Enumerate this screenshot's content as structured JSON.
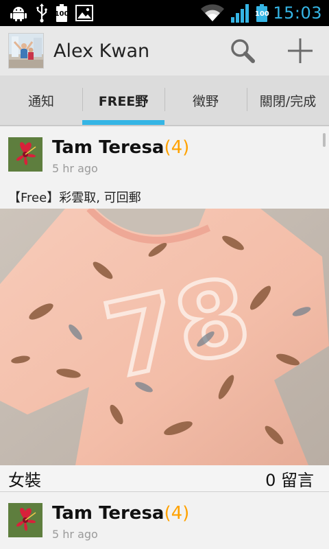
{
  "status_bar": {
    "battery_1": "100",
    "battery_2": "100",
    "time": "15:03",
    "icons": [
      "android-debug-icon",
      "usb-icon",
      "battery-icon",
      "image-icon",
      "wifi-icon",
      "signal-icon",
      "battery-charging-icon"
    ]
  },
  "action_bar": {
    "title": "Alex Kwan",
    "actions": [
      "search-icon",
      "add-icon"
    ]
  },
  "tabs": [
    {
      "label": "通知",
      "active": false
    },
    {
      "label": "FREE野",
      "active": true
    },
    {
      "label": "徵野",
      "active": false
    },
    {
      "label": "關閉/完成",
      "active": false
    }
  ],
  "posts": [
    {
      "author": "Tam Teresa",
      "count": "(4)",
      "time": "5 hr ago",
      "desc": "【Free】彩雲取, 可回郵",
      "category": "女裝",
      "comments": "0 留言"
    },
    {
      "author": "Tam Teresa",
      "count": "(4)",
      "time": "5 hr ago"
    }
  ],
  "colors": {
    "accent": "#35b5e5",
    "count": "#ffa200"
  }
}
